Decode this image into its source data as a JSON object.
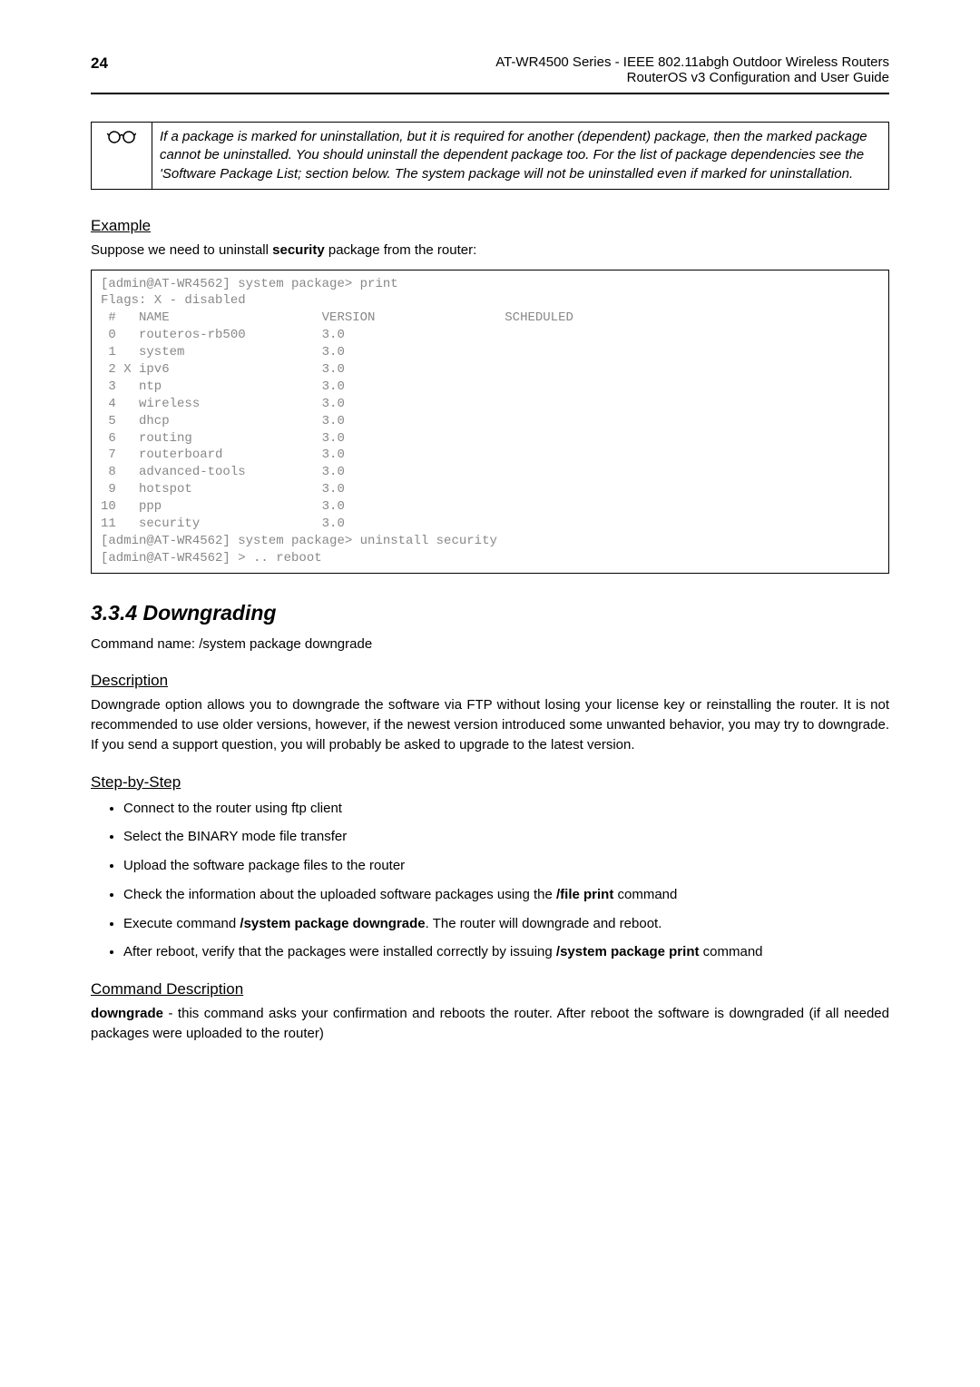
{
  "header": {
    "page_number": "24",
    "title_line1": "AT-WR4500 Series - IEEE 802.11abgh Outdoor Wireless Routers",
    "title_line2": "RouterOS v3 Configuration and User Guide"
  },
  "note": {
    "text": "If a package is marked for uninstallation, but it is required for another (dependent) package, then the marked package cannot be uninstalled. You should uninstall the dependent package too. For the list of package dependencies see the 'Software Package List; section below. The system package will not be uninstalled even if marked for uninstallation."
  },
  "example": {
    "heading": "Example",
    "intro_prefix": "Suppose we need to uninstall ",
    "intro_bold": "security",
    "intro_suffix": " package from the router:",
    "code": "[admin@AT-WR4562] system package> print\nFlags: X - disabled\n #   NAME                    VERSION                 SCHEDULED\n 0   routeros-rb500          3.0\n 1   system                  3.0\n 2 X ipv6                    3.0\n 3   ntp                     3.0\n 4   wireless                3.0\n 5   dhcp                    3.0\n 6   routing                 3.0\n 7   routerboard             3.0\n 8   advanced-tools          3.0\n 9   hotspot                 3.0\n10   ppp                     3.0\n11   security                3.0\n[admin@AT-WR4562] system package> uninstall security\n[admin@AT-WR4562] > .. reboot"
  },
  "downgrading": {
    "heading": "3.3.4 Downgrading",
    "command_name": "Command name: /system package downgrade",
    "description_heading": "Description",
    "description_text": "Downgrade option allows you to downgrade the software via FTP without losing your license key or reinstalling the router. It is not recommended to use older versions, however, if the newest version introduced some unwanted behavior, you may try to downgrade. If you send a support question, you will probably be asked to upgrade to the latest version.",
    "step_heading": "Step-by-Step",
    "steps": {
      "s1": "Connect to the router using ftp client",
      "s2": "Select the BINARY mode file transfer",
      "s3": "Upload the software package files to the router",
      "s4_prefix": "Check the information about the uploaded software packages using the ",
      "s4_bold": "/file print",
      "s4_suffix": " command",
      "s5_prefix": "Execute command ",
      "s5_bold": "/system package downgrade",
      "s5_suffix": ". The router will downgrade and reboot.",
      "s6_prefix": "After reboot, verify that the packages were installed correctly by issuing ",
      "s6_bold": "/system package print",
      "s6_suffix": " command"
    },
    "command_desc_heading": "Command Description",
    "command_desc_bold": "downgrade",
    "command_desc_text": " - this command asks your confirmation and reboots the router. After reboot the software is downgraded (if all needed packages were uploaded to the router)"
  }
}
